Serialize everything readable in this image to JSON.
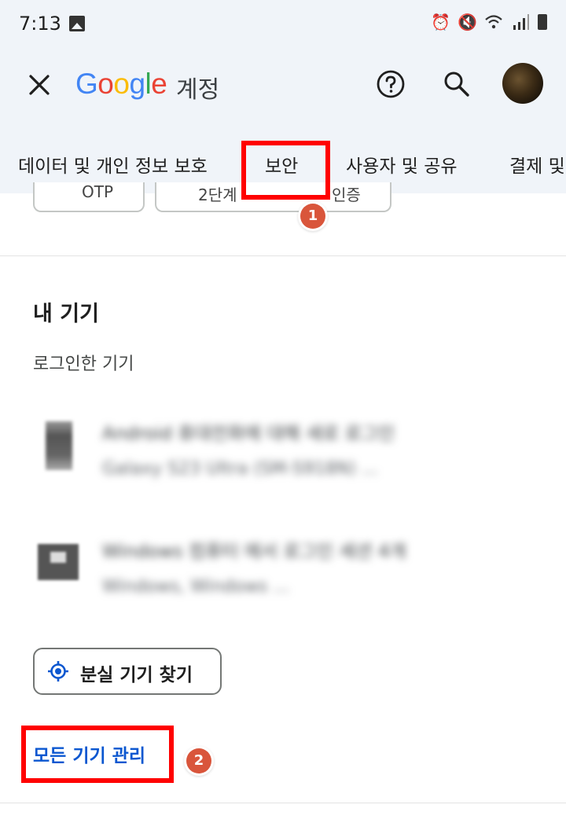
{
  "status_bar": {
    "time": "7:13",
    "icons": [
      "gallery-icon",
      "alarm-icon",
      "mute-icon",
      "wifi-icon",
      "signal-icon",
      "battery-icon"
    ]
  },
  "app_bar": {
    "logo_text": "Google",
    "title_suffix": "계정",
    "icons": [
      "close-icon",
      "help-icon",
      "search-icon",
      "avatar"
    ]
  },
  "tabs": [
    {
      "label": "데이터 및 개인 정보 보호"
    },
    {
      "label": "보안",
      "selected": true
    },
    {
      "label": "사용자 및 공유"
    },
    {
      "label": "결제 및"
    }
  ],
  "partial_chips": [
    "OTP",
    "2단계",
    "인증"
  ],
  "devices_section": {
    "title": "내 기기",
    "subtitle": "로그인한 기기",
    "devices": [
      {
        "icon": "phone-icon",
        "line1": "Android 휴대전화에 대해 새로 로그인",
        "line2": "Galaxy S23 Ultra (SM-S918N) ..."
      },
      {
        "icon": "laptop-icon",
        "line1": "Windows 컴퓨터 에서 로그인 세션 4개",
        "line2": "Windows, Windows ..."
      }
    ],
    "find_button": "분실 기기 찾기",
    "manage_link": "모든 기기 관리"
  },
  "annotations": {
    "marker_1": "1",
    "marker_2": "2",
    "highlight_color": "#ff0000",
    "marker_color": "#d9553b"
  },
  "colors": {
    "header_bg": "#f0f4f9",
    "accent": "#0b57d0"
  }
}
